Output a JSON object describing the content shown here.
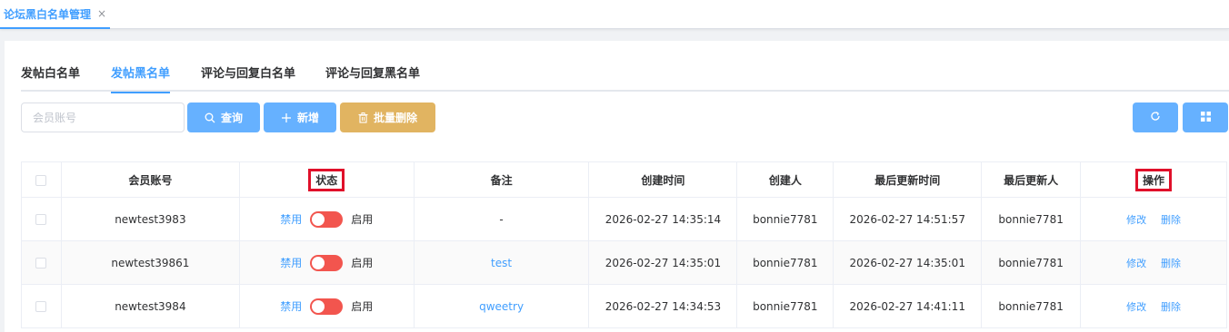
{
  "page_tab": {
    "label": "论坛黑白名单管理",
    "close": "×"
  },
  "tabs": [
    "发帖白名单",
    "发帖黑名单",
    "评论与回复白名单",
    "评论与回复黑名单"
  ],
  "active_tab": 1,
  "search": {
    "placeholder": "会员账号",
    "value": ""
  },
  "toolbar": {
    "query_label": "查询",
    "add_label": "新增",
    "batch_delete_label": "批量删除",
    "icons": {
      "query": "search-icon",
      "add": "plus-icon",
      "batch_delete": "trash-icon",
      "refresh": "refresh-icon",
      "layout": "grid-icon"
    }
  },
  "table": {
    "columns": [
      "会员账号",
      "状态",
      "备注",
      "创建时间",
      "创建人",
      "最后更新时间",
      "最后更新人",
      "操作"
    ],
    "highlighted_columns": [
      "状态",
      "操作"
    ],
    "rows": [
      {
        "account": "newtest3983",
        "status_off": "禁用",
        "status_on": "启用",
        "remark": "-",
        "created_at": "2026-02-27 14:35:14",
        "creator": "bonnie7781",
        "updated_at": "2026-02-27 14:51:57",
        "updater": "bonnie7781",
        "edit": "修改",
        "delete": "删除"
      },
      {
        "account": "newtest39861",
        "status_off": "禁用",
        "status_on": "启用",
        "remark": "test",
        "created_at": "2026-02-27 14:35:01",
        "creator": "bonnie7781",
        "updated_at": "2026-02-27 14:35:01",
        "updater": "bonnie7781",
        "edit": "修改",
        "delete": "删除"
      },
      {
        "account": "newtest3984",
        "status_off": "禁用",
        "status_on": "启用",
        "remark": "qweetry",
        "created_at": "2026-02-27 14:34:53",
        "creator": "bonnie7781",
        "updated_at": "2026-02-27 14:41:11",
        "updater": "bonnie7781",
        "edit": "修改",
        "delete": "删除"
      }
    ]
  },
  "colors": {
    "primary": "#409eff",
    "button": "#66b1ff",
    "warning_button": "#e1b461",
    "switch_off": "#f2554e",
    "highlight_box": "#e0102a"
  }
}
